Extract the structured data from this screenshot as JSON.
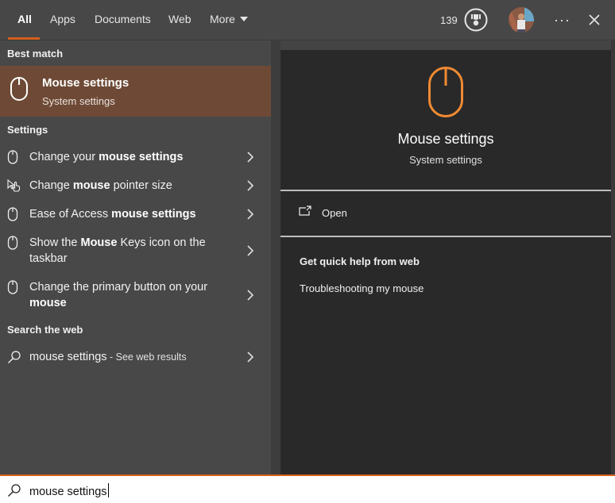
{
  "tabs": [
    {
      "label": "All",
      "active": true
    },
    {
      "label": "Apps"
    },
    {
      "label": "Documents"
    },
    {
      "label": "Web"
    },
    {
      "label": "More"
    }
  ],
  "header": {
    "points": "139",
    "rewards_icon": "trophy-icon",
    "avatar": "user-avatar",
    "more_icon": "ellipsis-icon",
    "close_icon": "close-icon"
  },
  "best_match": {
    "section_label": "Best match",
    "title": "Mouse settings",
    "subtitle": "System settings",
    "icon": "mouse-icon"
  },
  "settings": {
    "section_label": "Settings",
    "items": [
      {
        "icon": "mouse-icon",
        "parts": [
          {
            "t": "Change your ",
            "b": false
          },
          {
            "t": "mouse settings",
            "b": true
          }
        ]
      },
      {
        "icon": "pointer-icon",
        "parts": [
          {
            "t": "Change ",
            "b": false
          },
          {
            "t": "mouse",
            "b": true
          },
          {
            "t": " pointer size",
            "b": false
          }
        ]
      },
      {
        "icon": "mouse-icon",
        "parts": [
          {
            "t": "Ease of Access ",
            "b": false
          },
          {
            "t": "mouse settings",
            "b": true
          }
        ]
      },
      {
        "icon": "mouse-icon",
        "parts": [
          {
            "t": "Show the ",
            "b": false
          },
          {
            "t": "Mouse",
            "b": true
          },
          {
            "t": " Keys icon on the taskbar",
            "b": false
          }
        ]
      },
      {
        "icon": "mouse-icon",
        "parts": [
          {
            "t": "Change the primary button on your ",
            "b": false
          },
          {
            "t": "mouse",
            "b": true
          }
        ]
      }
    ]
  },
  "web": {
    "section_label": "Search the web",
    "query": "mouse settings",
    "suffix": " - See web results"
  },
  "preview": {
    "title": "Mouse settings",
    "subtitle": "System settings",
    "open_label": "Open",
    "help_heading": "Get quick help from web",
    "help_links": [
      "Troubleshooting my mouse"
    ]
  },
  "search": {
    "value": "mouse settings"
  },
  "colors": {
    "accent": "#d35f1c",
    "selected_bg": "#6e4a36",
    "preview_icon": "#f08a32"
  }
}
